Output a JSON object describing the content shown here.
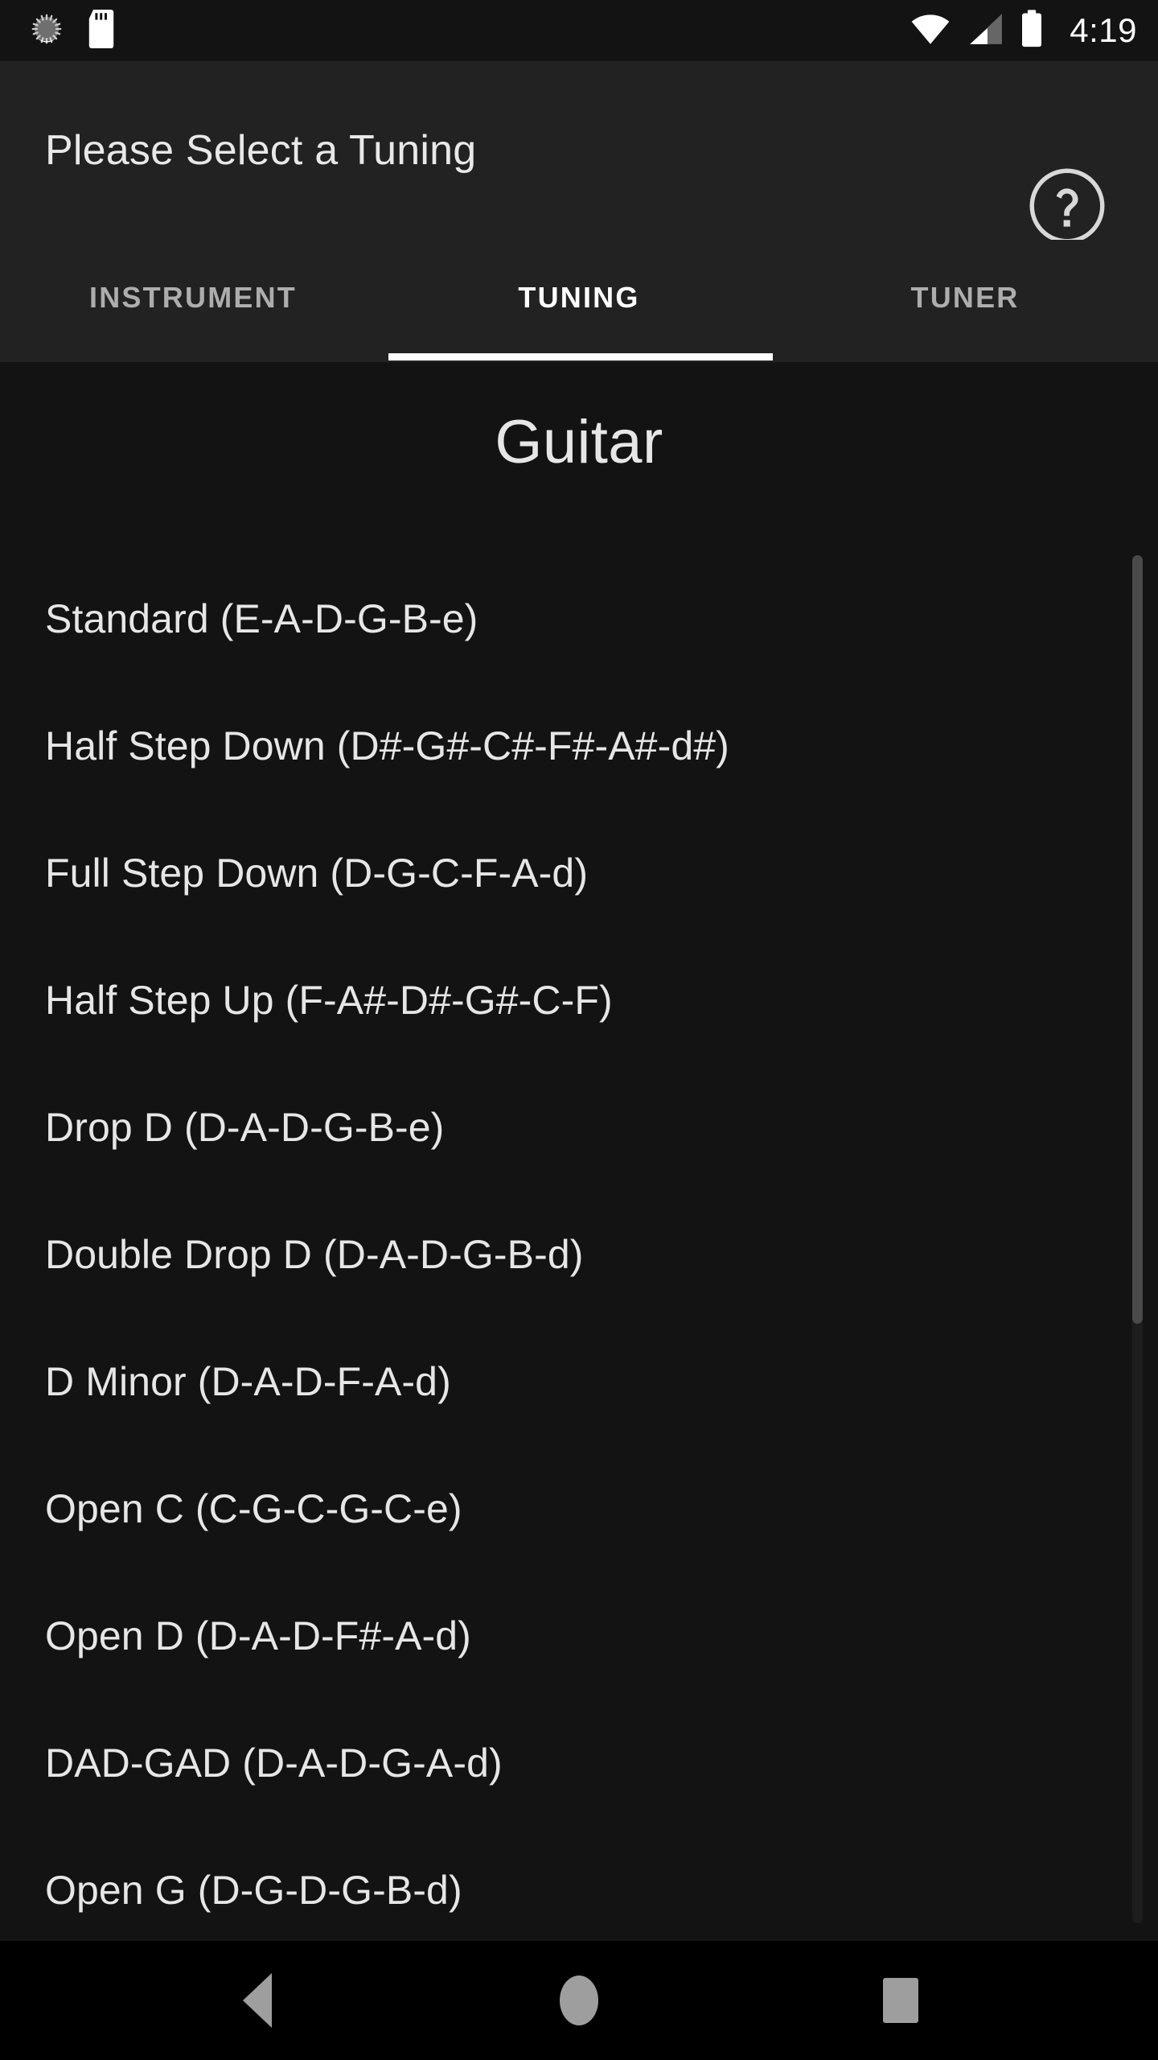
{
  "status_bar": {
    "icons": [
      "sync-spinner-icon",
      "sd-card-icon",
      "wifi-icon",
      "cellular-signal-icon",
      "battery-icon"
    ],
    "time": "4:19"
  },
  "app_bar": {
    "title": "Please Select a Tuning",
    "help_icon": "help-circle-icon"
  },
  "tabs": [
    {
      "label": "INSTRUMENT",
      "active": false
    },
    {
      "label": "TUNING",
      "active": true
    },
    {
      "label": "TUNER",
      "active": false
    }
  ],
  "content": {
    "instrument_heading": "Guitar",
    "tuning_items": [
      {
        "label": "Standard (E-A-D-G-B-e)"
      },
      {
        "label": "Half Step Down (D#-G#-C#-F#-A#-d#)"
      },
      {
        "label": "Full Step Down (D-G-C-F-A-d)"
      },
      {
        "label": "Half Step Up (F-A#-D#-G#-C-F)"
      },
      {
        "label": "Drop D (D-A-D-G-B-e)"
      },
      {
        "label": "Double Drop D (D-A-D-G-B-d)"
      },
      {
        "label": "D Minor (D-A-D-F-A-d)"
      },
      {
        "label": "Open C (C-G-C-G-C-e)"
      },
      {
        "label": "Open D (D-A-D-F#-A-d)"
      },
      {
        "label": "DAD-GAD (D-A-D-G-A-d)"
      },
      {
        "label": "Open G (D-G-D-G-B-d)"
      }
    ]
  },
  "nav_bar": {
    "back": "back-triangle-icon",
    "home": "home-circle-icon",
    "recents": "recents-square-icon"
  },
  "colors": {
    "status_bar_bg": "#131313",
    "app_bar_bg": "#222222",
    "content_bg": "#131313",
    "nav_bar_bg": "#000000",
    "accent_indicator": "#ffffff",
    "primary_text": "#e6e6e6",
    "inactive_tab_text": "#adadad",
    "nav_icon": "#9e9e9e",
    "scroll_thumb": "#4a4a4a"
  }
}
